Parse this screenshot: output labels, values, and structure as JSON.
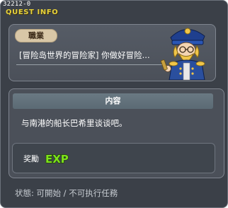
{
  "window": {
    "id_code": "32212-0",
    "title": "QUEST INFO"
  },
  "header": {
    "job_tag": "職業",
    "quest_name": "[冒险岛世界的冒险家] 你做好冒险..."
  },
  "content": {
    "section_title": "内容",
    "description": "与南港的船长巴希里谈谈吧。",
    "reward_label": "奖勵",
    "reward_exp": "EXP"
  },
  "status": {
    "text": "状態:  可開始 / 不可执行任務"
  },
  "colors": {
    "title_yellow": "#e6d23a",
    "exp_green": "#7de21b",
    "panel_bg": "#4b5059"
  },
  "icons": {
    "npc": "captain-portrait-icon",
    "exp": "exp-badge-icon",
    "close": "close-icon"
  }
}
